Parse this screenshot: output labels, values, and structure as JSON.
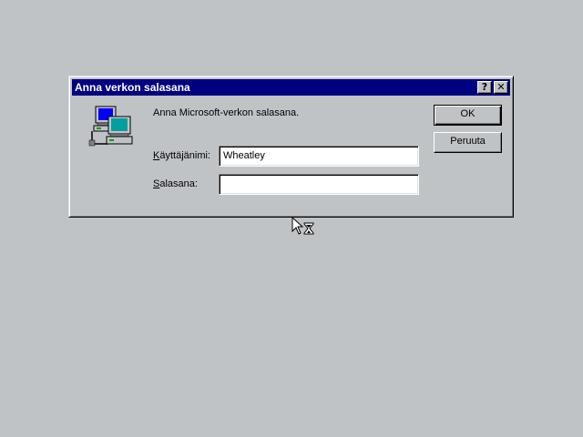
{
  "dialog": {
    "title": "Anna verkon salasana",
    "prompt": "Anna Microsoft-verkon salasana.",
    "username_label_first": "K",
    "username_label_rest": "äyttäjänimi:",
    "username_value": "Wheatley",
    "password_label_first": "S",
    "password_label_rest": "alasana:",
    "password_value": "",
    "ok_label": "OK",
    "cancel_label": "Peruuta",
    "help_glyph": "?",
    "close_glyph": "✕"
  },
  "icons": {
    "dialog_icon": "network-computers-icon",
    "cursor": "busy-arrow-hourglass-icon"
  },
  "colors": {
    "desktop": "#c0c3c6",
    "titlebar": "#000080",
    "monitor_screen_blue": "#0000ff",
    "monitor_screen_teal": "#00a0a0"
  }
}
